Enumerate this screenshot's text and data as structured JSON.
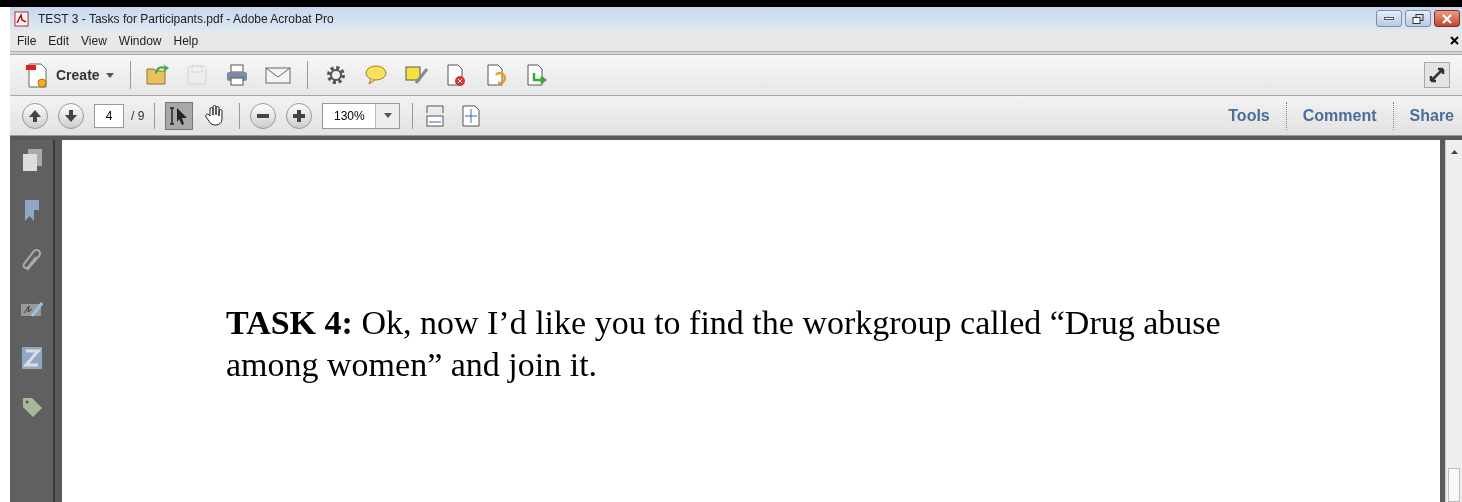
{
  "window": {
    "title": "TEST 3 - Tasks for Participants.pdf - Adobe Acrobat Pro"
  },
  "menu": [
    "File",
    "Edit",
    "View",
    "Window",
    "Help"
  ],
  "toolbar": {
    "create": "Create",
    "buttons": [
      {
        "kind": "open",
        "disabled": false
      },
      {
        "kind": "save",
        "disabled": true
      },
      {
        "kind": "print",
        "disabled": false
      },
      {
        "kind": "email",
        "disabled": false
      },
      {
        "kind": "settings",
        "disabled": false
      },
      {
        "kind": "comment",
        "disabled": false
      },
      {
        "kind": "highlight",
        "disabled": false
      },
      {
        "kind": "delete",
        "disabled": false
      },
      {
        "kind": "export",
        "disabled": false
      },
      {
        "kind": "import",
        "disabled": false
      }
    ]
  },
  "nav": {
    "page": "4",
    "total": "/ 9",
    "zoom": "130%",
    "tools": [
      {
        "kind": "select",
        "selected": true
      },
      {
        "kind": "hand",
        "selected": false
      }
    ]
  },
  "panes": [
    {
      "label": "Tools"
    },
    {
      "label": "Comment"
    },
    {
      "label": "Share"
    }
  ],
  "document": {
    "text": "**TASK 4:** Ok, now I’d like you to find the workgroup called “Drug abuse among women” and join it."
  }
}
